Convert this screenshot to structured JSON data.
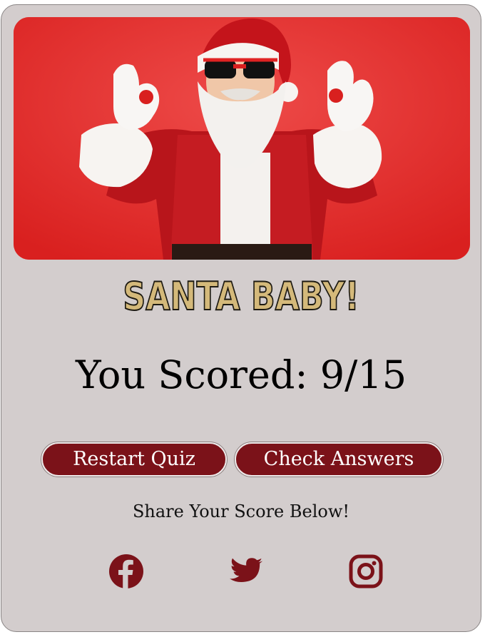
{
  "quiz_result": {
    "title": "SANTA BABY!",
    "score_text": "You Scored: 9/15",
    "score": {
      "correct": 9,
      "total": 15
    }
  },
  "actions": {
    "restart_label": "Restart Quiz",
    "check_label": "Check Answers"
  },
  "share": {
    "label": "Share Your Score Below!",
    "icons": [
      "facebook-icon",
      "twitter-icon",
      "instagram-icon"
    ]
  },
  "colors": {
    "card_background": "#d3cdcd",
    "button_background": "#7b1219",
    "title_fill": "#d4b97a",
    "icon_color": "#7b1219",
    "hero_background": "#e5322f"
  }
}
